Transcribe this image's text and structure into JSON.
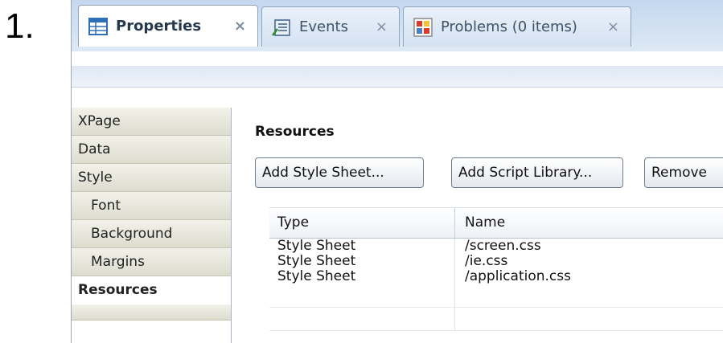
{
  "step_number": "1.",
  "tabs": [
    {
      "label": "Properties",
      "icon": "properties-grid-icon",
      "active": true
    },
    {
      "label": "Events",
      "icon": "events-list-icon",
      "active": false
    },
    {
      "label": "Problems (0 items)",
      "icon": "problems-icon",
      "active": false
    }
  ],
  "tab_close_glyph": "×",
  "sidebar": {
    "items": [
      {
        "label": "XPage"
      },
      {
        "label": "Data"
      },
      {
        "label": "Style"
      },
      {
        "label": "Font"
      },
      {
        "label": "Background"
      },
      {
        "label": "Margins"
      },
      {
        "label": "Resources"
      }
    ]
  },
  "resources": {
    "title": "Resources",
    "buttons": {
      "add_style_sheet": "Add Style Sheet...",
      "add_script_library": "Add Script Library...",
      "remove": "Remove"
    },
    "columns": {
      "type": "Type",
      "name": "Name"
    },
    "rows": [
      {
        "type": "Style Sheet",
        "name": "/screen.css"
      },
      {
        "type": "Style Sheet",
        "name": "/ie.css"
      },
      {
        "type": "Style Sheet",
        "name": "/application.css"
      }
    ]
  },
  "colors": {
    "tab_bar": "#c4d8ee",
    "sidebar_item": "#dcdccf",
    "selected_item": "#ffffff"
  }
}
